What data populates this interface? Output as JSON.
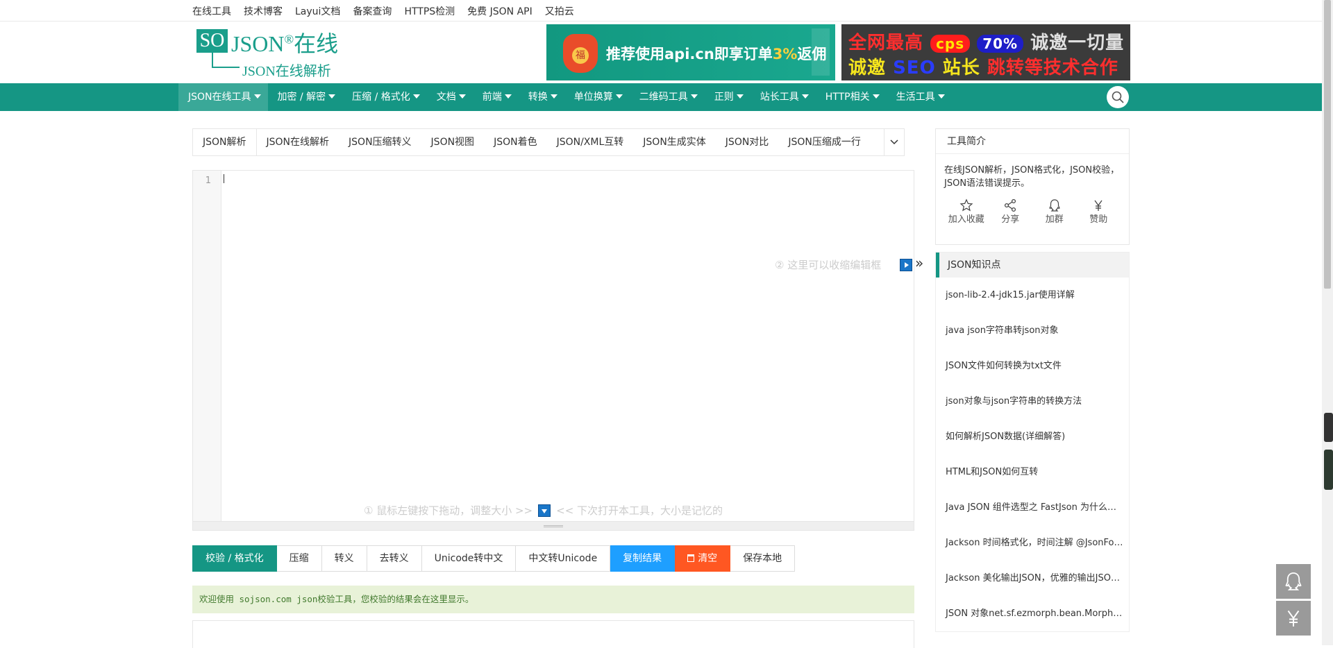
{
  "topbar": {
    "links": [
      "在线工具",
      "技术博客",
      "Layui文档",
      "备案查询",
      "HTTPS检测",
      "免费 JSON API",
      "又拍云"
    ]
  },
  "logo": {
    "so": "SO",
    "brand": "JSON",
    "brand_cn": "在线",
    "reg": "®",
    "sub": "JSON在线解析"
  },
  "ads": {
    "ad1": {
      "icon_char": "福",
      "text": "推荐使用api.cn即享订单",
      "percent": "3%",
      "text_end": "返佣"
    },
    "ad2": {
      "r1a": "全网最高",
      "r1b": "cps",
      "r1c": "70%",
      "r1d": "诚邀一切量",
      "r2a": "诚邀",
      "r2b": "SEO",
      "r2c": "站长",
      "r2d": "跳转等技术合作"
    }
  },
  "nav": {
    "items": [
      "JSON在线工具",
      "加密 / 解密",
      "压缩 / 格式化",
      "文档",
      "前端",
      "转换",
      "单位换算",
      "二维码工具",
      "正则",
      "站长工具",
      "HTTP相关",
      "生活工具"
    ]
  },
  "tabs": [
    "JSON解析",
    "JSON在线解析",
    "JSON压缩转义",
    "JSON视图",
    "JSON着色",
    "JSON/XML互转",
    "JSON生成实体",
    "JSON对比",
    "JSON压缩成一行"
  ],
  "editor": {
    "line_number": "1",
    "hint_collapse": "② 这里可以收缩编辑框",
    "collapse_arrows": "»",
    "hint_resize": "① 鼠标左键按下拖动，调整大小 >>",
    "hint_resize2": "<< 下次打开本工具，大小是记忆的"
  },
  "actions": [
    "校验 / 格式化",
    "压缩",
    "转义",
    "去转义",
    "Unicode转中文",
    "中文转Unicode",
    "复制结果",
    "清空",
    "保存本地"
  ],
  "result_message": "欢迎使用 sojson.com json校验工具，您校验的结果会在这里显示。",
  "sidebar": {
    "intro_title": "工具简介",
    "intro_text": "在线JSON解析，JSON格式化，JSON校验，JSON语法错误提示。",
    "tools": [
      {
        "icon": "star-icon",
        "label": "加入收藏"
      },
      {
        "icon": "share-icon",
        "label": "分享"
      },
      {
        "icon": "qq-icon",
        "label": "加群"
      },
      {
        "icon": "yen-icon",
        "label": "赞助"
      }
    ],
    "knowledge_title": "JSON知识点",
    "knowledge_items": [
      "json-lib-2.4-jdk15.jar使用详解",
      "java json字符串转json对象",
      "JSON文件如何转换为txt文件",
      "json对象与json字符串的转换方法",
      "如何解析JSON数据(详细解答)",
      "HTML和JSON如何互转",
      "Java JSON 组件选型之 FastJson 为什么用不起来",
      "Jackson 时间格式化，时间注解 @JsonFormat",
      "Jackson 美化输出JSON，优雅的输出JSON数据",
      "JSON 对象net.sf.ezmorph.bean.MorphDynaBean"
    ]
  },
  "colors": {
    "brand": "#159684",
    "blue": "#1e9fff",
    "orange": "#ff5722"
  }
}
